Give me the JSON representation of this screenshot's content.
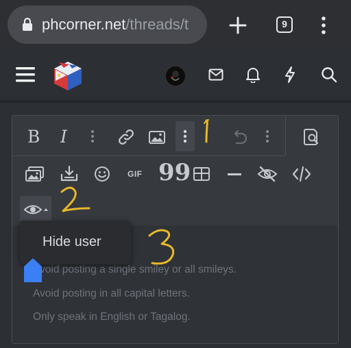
{
  "browser": {
    "url_domain": "phcorner.net",
    "url_path": "/threads/t",
    "tab_count": "9"
  },
  "site_header": {
    "icons": [
      "menu-icon",
      "site-logo",
      "avatar",
      "mail-icon",
      "bell-icon",
      "lightning-icon",
      "search-icon"
    ]
  },
  "toolbar": {
    "row1": [
      "bold",
      "italic",
      "more-text",
      "link",
      "image",
      "more-insert",
      "undo",
      "more-options",
      "preview"
    ],
    "bold_label": "B",
    "italic_label": "I",
    "row2": [
      "media",
      "attach",
      "smilie",
      "gif",
      "quote",
      "table",
      "horizontal-line",
      "hide",
      "code"
    ],
    "gif_label": "GIF",
    "quote_label": "99"
  },
  "dropdown": {
    "item": "Hide user"
  },
  "content": {
    "lines": [
      "Avoid posting a single smiley or all smileys.",
      "Avoid posting in all capital letters.",
      "Only speak in English or Tagalog."
    ]
  },
  "annotations": [
    "1",
    "2",
    "3"
  ],
  "colors": {
    "annotation": "#e8b92a",
    "handle": "#3b7ff5",
    "loading": "#d9534f"
  }
}
